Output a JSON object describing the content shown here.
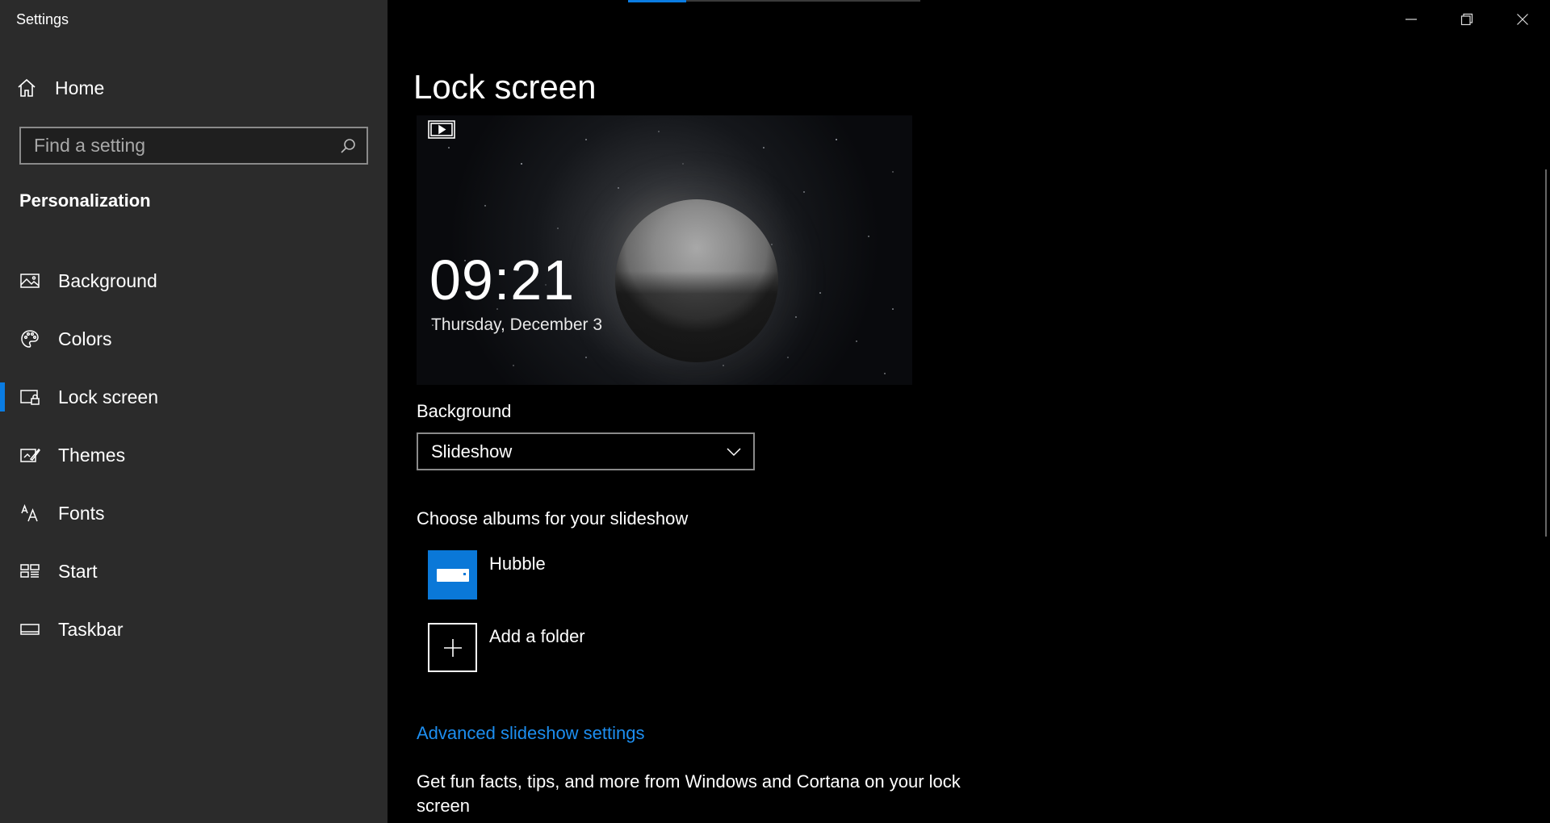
{
  "window": {
    "title": "Settings"
  },
  "sidebar": {
    "home_label": "Home",
    "search_placeholder": "Find a setting",
    "section_heading": "Personalization",
    "items": [
      {
        "id": "background",
        "label": "Background",
        "icon": "picture-icon"
      },
      {
        "id": "colors",
        "label": "Colors",
        "icon": "palette-icon"
      },
      {
        "id": "lock-screen",
        "label": "Lock screen",
        "icon": "lock-screen-icon",
        "active": true
      },
      {
        "id": "themes",
        "label": "Themes",
        "icon": "themes-icon"
      },
      {
        "id": "fonts",
        "label": "Fonts",
        "icon": "fonts-icon"
      },
      {
        "id": "start",
        "label": "Start",
        "icon": "start-icon"
      },
      {
        "id": "taskbar",
        "label": "Taskbar",
        "icon": "taskbar-icon"
      }
    ]
  },
  "main": {
    "page_title": "Lock screen",
    "preview": {
      "time": "09:21",
      "date": "Thursday, December 3"
    },
    "background_label": "Background",
    "background_value": "Slideshow",
    "albums_label": "Choose albums for your slideshow",
    "albums": [
      {
        "name": "Hubble",
        "icon": "drive-icon"
      },
      {
        "name": "Add a folder",
        "icon": "plus-icon"
      }
    ],
    "advanced_link": "Advanced slideshow settings",
    "fun_facts_text": "Get fun facts, tips, and more from Windows and Cortana on your lock screen"
  },
  "colors": {
    "accent": "#0a7ce2",
    "sidebar_bg": "#2b2b2b",
    "main_bg": "#000000",
    "link": "#1d8ef0"
  }
}
